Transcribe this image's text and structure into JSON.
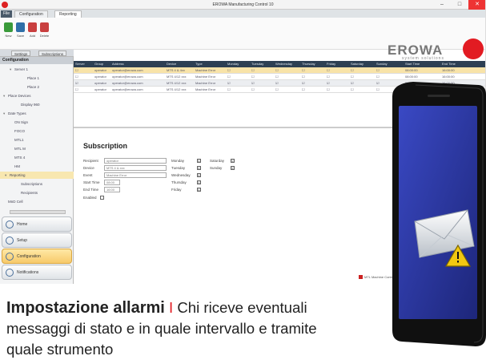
{
  "window": {
    "title": "EROWA Manufacturing Control 10",
    "min": "–",
    "max": "□",
    "close": "✕"
  },
  "tabs": {
    "file": "File",
    "items": [
      "Configuration",
      "Reporting"
    ]
  },
  "toolbar": {
    "buttons": [
      {
        "label": "New",
        "color": "#3a9a3a"
      },
      {
        "label": "Save",
        "color": "#2f6fa8"
      },
      {
        "label": "Add",
        "color": "#c94040"
      },
      {
        "label": "Delete",
        "color": "#c94040"
      }
    ]
  },
  "logo": {
    "brand": "EROWA",
    "sub": "system solutions",
    "color": "#e21b22"
  },
  "panel_tabs": [
    "Settings",
    "Subscriptions"
  ],
  "sidebar": {
    "header": "Configuration",
    "tree": [
      {
        "label": "Server 1",
        "expander": "▾",
        "indent": 1
      },
      {
        "label": "Place 1",
        "expander": "",
        "indent": 3
      },
      {
        "label": "Place 2",
        "expander": "",
        "indent": 3
      },
      {
        "label": "Place Devices",
        "expander": "▾",
        "indent": 0
      },
      {
        "label": "Display 960",
        "expander": "",
        "indent": 2
      },
      {
        "label": "Date Types",
        "expander": "▾",
        "indent": 0
      },
      {
        "label": "ON Sign",
        "expander": "",
        "indent": 1
      },
      {
        "label": "FOCO",
        "expander": "",
        "indent": 1
      },
      {
        "label": "MTL1",
        "expander": "",
        "indent": 1
      },
      {
        "label": "MTL M",
        "expander": "",
        "indent": 1
      },
      {
        "label": "MTS 4",
        "expander": "",
        "indent": 1
      },
      {
        "label": "HM",
        "expander": "",
        "indent": 1
      },
      {
        "label": "Reporting",
        "expander": "▾",
        "indent": 0,
        "selected": true
      },
      {
        "label": "Subscriptions",
        "expander": "",
        "indent": 2
      },
      {
        "label": "Recipients",
        "expander": "",
        "indent": 2
      },
      {
        "label": "MnD Cell",
        "expander": "",
        "indent": 0
      }
    ],
    "nav": [
      "Home",
      "Setup",
      "Configuration",
      "Notifications"
    ],
    "nav_active": 2
  },
  "grid": {
    "columns": [
      "Server",
      "Group",
      "Address",
      "Device",
      "Type",
      "Monday",
      "Tuesday",
      "Wednesday",
      "Thursday",
      "Friday",
      "Saturday",
      "Sunday",
      "Start Time",
      "End Time"
    ],
    "rows": [
      [
        "☐",
        "operator",
        "operator@erowa.com",
        "MTS 4 & 4xx",
        "Machine Error",
        "☐",
        "☐",
        "☐",
        "☐",
        "☐",
        "☐",
        "☐",
        "08:00:00",
        "16:00:00"
      ],
      [
        "☐",
        "operator",
        "operator@erowa.com",
        "MTS 4/12 xxx",
        "Machine Error",
        "☐",
        "☐",
        "☐",
        "☐",
        "☐",
        "☐",
        "☐",
        "08:00:00",
        "16:00:00"
      ],
      [
        "☑",
        "operator",
        "operator@erowa.com",
        "MTS 4/12 xxx",
        "Machine Error",
        "☑",
        "☑",
        "☑",
        "☑",
        "☑",
        "☑",
        "☑",
        "08:00:00",
        "16:00:00"
      ],
      [
        "☐",
        "operator",
        "operator@erowa.com",
        "MTS 4/12 xxx",
        "Machine Error",
        "☐",
        "☐",
        "☐",
        "☐",
        "☐",
        "☐",
        "☐",
        "08:00:00",
        "16:00:00"
      ]
    ]
  },
  "subscription": {
    "title": "Subscription",
    "fields": [
      {
        "label": "Recipient",
        "value": "operator"
      },
      {
        "label": "Device",
        "value": "MTS 4 & xxx"
      },
      {
        "label": "Event",
        "value": "Machine Error"
      },
      {
        "label": "Start Time",
        "value": "08:00"
      },
      {
        "label": "End Time",
        "value": "16:00"
      }
    ],
    "enabled": "Enabled",
    "days_left": [
      {
        "label": "Monday",
        "checked": "☑"
      },
      {
        "label": "Tuesday",
        "checked": "☑"
      },
      {
        "label": "Wednesday",
        "checked": "☑"
      },
      {
        "label": "Thursday",
        "checked": "☑"
      },
      {
        "label": "Friday",
        "checked": "☑"
      }
    ],
    "days_right": [
      {
        "label": "Saturday",
        "checked": "☑"
      },
      {
        "label": "Sunday",
        "checked": "☑"
      }
    ]
  },
  "statusbar": {
    "text": "MTL Machine Control"
  },
  "caption": {
    "heading": "Impostazione allarmi",
    "separator": "I",
    "line1": " Chi riceve eventuali",
    "line2": "messaggi di stato e in quale intervallo e tramite",
    "line3": "quale strumento"
  },
  "phone": {
    "icon": "email-warning-icon",
    "screen_color": "#2c3aa8"
  }
}
